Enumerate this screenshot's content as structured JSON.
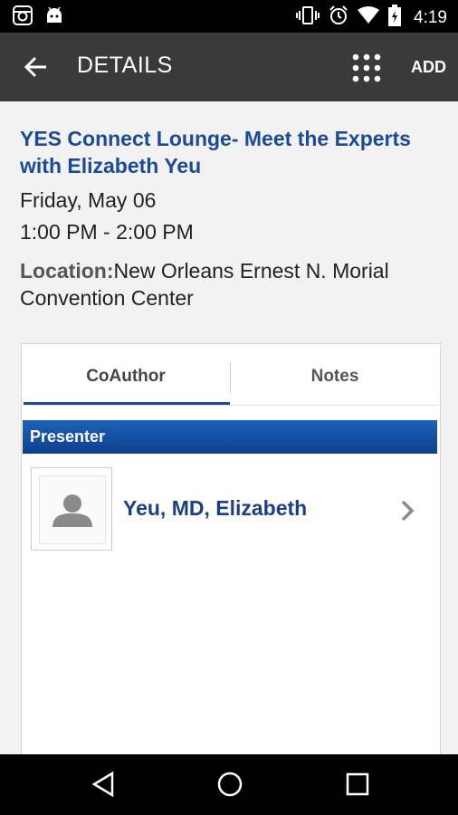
{
  "statusbar": {
    "time": "4:19"
  },
  "appbar": {
    "title": "DETAILS",
    "add_label": "ADD"
  },
  "session": {
    "title": "YES Connect Lounge- Meet the Experts with Elizabeth Yeu",
    "date": "Friday, May 06",
    "time_range": "1:00 PM - 2:00 PM",
    "location_label": "Location:",
    "location_value": "New Orleans Ernest N. Morial Convention Center"
  },
  "tabs": [
    {
      "label": "CoAuthor",
      "selected": true
    },
    {
      "label": "Notes",
      "selected": false
    }
  ],
  "section": {
    "header": "Presenter"
  },
  "presenter": {
    "name": "Yeu, MD, Elizabeth"
  },
  "colors": {
    "accent": "#1b4a96",
    "appbar": "#3a3a3a",
    "section_header": "#1e62b8"
  },
  "icons": {
    "status_left": [
      "instagram-icon",
      "android-icon"
    ],
    "status_right": [
      "vibrate-icon",
      "alarm-icon",
      "wifi-icon",
      "battery-icon"
    ],
    "appbar": [
      "back-arrow-icon",
      "grid-menu-icon"
    ],
    "nav": [
      "back-triangle-icon",
      "home-circle-icon",
      "recents-square-icon"
    ]
  }
}
